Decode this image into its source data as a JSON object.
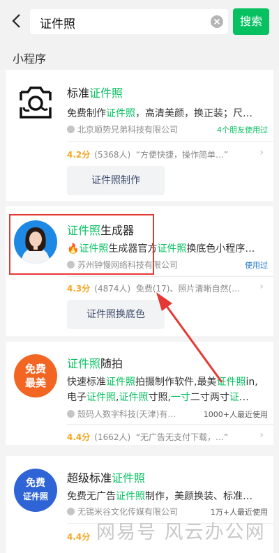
{
  "search": {
    "query": "证件照",
    "button_label": "搜索"
  },
  "section": {
    "title": "小程序"
  },
  "results": [
    {
      "name_plain": "标准",
      "name_hl": "证件照",
      "name_suffix": "",
      "desc_parts": [
        "免费制作",
        "证件照",
        "，高清美颜，换正装；尺…"
      ],
      "company": "北京顺势兄弟科技有限公司",
      "usage": "4个朋友使用过",
      "score": "4.2分",
      "rating_count": "(5368人)",
      "rating_text": "“方便快捷，操作简单…”",
      "service": "证件照制作"
    },
    {
      "name_plain": "",
      "name_hl": "证件照",
      "name_suffix": "生成器",
      "desc_parts": [
        "🔥",
        "证件照",
        "生成器官方",
        "证件照",
        "换底色小程序…"
      ],
      "company": "苏州钟慢网络科技有限公司",
      "usage": "使用过",
      "score": "4.3分",
      "rating_count": "(4874人)",
      "rating_text": "免费(17)、照片清晰自然(…",
      "service": "证件照换底色"
    },
    {
      "name_plain": "",
      "name_hl": "证件照",
      "name_suffix": "随拍",
      "logo_text": [
        "免费",
        "最美"
      ],
      "desc_line1": [
        "快速标准",
        "证件照",
        "拍摄制作软件,最美",
        "证件照",
        "in,"
      ],
      "desc_line2": [
        "电子",
        "证件照",
        ",",
        "证件照",
        "寸照,",
        "一寸",
        "二寸两寸",
        "证",
        "…"
      ],
      "company": "殼码人数字科技(天津)有…",
      "usage": "1000+人最近使用",
      "score": "4.4分",
      "rating_count": "(1662人)",
      "rating_text": "“无广告无支付下载，…”"
    },
    {
      "name_plain": "超级标准",
      "name_hl": "证件照",
      "name_suffix": "",
      "logo_text": [
        "免费",
        "证件照"
      ],
      "desc_parts": [
        "免费无广告",
        "证件照",
        "制作，美颜换装、标准…"
      ],
      "company": "无锡米谷文化传媒有限公司",
      "usage": "1万+人最近使用",
      "score": "4.4分"
    }
  ],
  "watermark": "网易号 风云办公网",
  "colors": {
    "accent": "#07c160",
    "rating": "#f5a623",
    "annotation": "#e53935"
  }
}
